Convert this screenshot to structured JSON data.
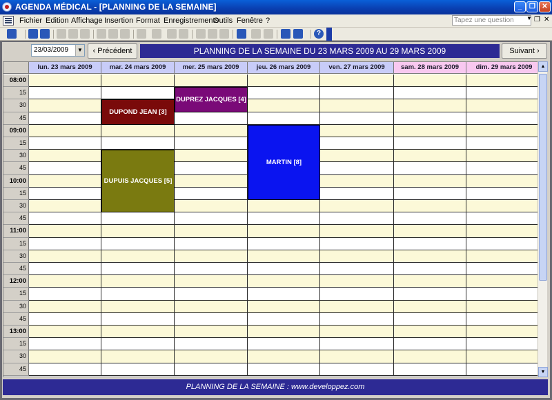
{
  "window": {
    "title": "AGENDA MÉDICAL - [PLANNING DE LA SEMAINE]",
    "minimize": "_",
    "maximize": "❐",
    "close": "✕"
  },
  "menu": {
    "items": [
      "Fichier",
      "Edition",
      "Affichage",
      "Insertion",
      "Format",
      "Enregistrements",
      "Outils",
      "Fenêtre",
      "?"
    ],
    "ask_placeholder": "Tapez une question",
    "ask_arrow": "▼",
    "doc_min": "_",
    "doc_restore": "❐",
    "doc_close": "✕"
  },
  "toolbar": {
    "icons": [
      "design-view-icon",
      "save-icon",
      "print-icon",
      "print-preview-icon",
      "spelling-icon",
      "cut-icon",
      "copy-icon",
      "paste-icon",
      "undo-icon",
      "hyperlink-icon",
      "sort-asc-icon",
      "sort-desc-icon",
      "filter-selection-icon",
      "filter-form-icon",
      "apply-filter-icon",
      "find-icon",
      "new-record-icon",
      "delete-record-icon",
      "database-window-icon",
      "new-object-icon",
      "help-icon"
    ],
    "help_label": "?"
  },
  "form": {
    "date_value": "23/03/2009",
    "date_dropdown": "▼",
    "prev_label": "‹  Précédent",
    "next_label": "Suivant  ›",
    "banner": "PLANNING DE LA SEMAINE DU 23 MARS 2009 AU 29 MARS 2009",
    "footer": "PLANNING DE LA SEMAINE : www.developpez.com"
  },
  "days": [
    {
      "label": "lun. 23 mars 2009",
      "color": "#c8ccf8"
    },
    {
      "label": "mar. 24 mars 2009",
      "color": "#c8ccf8"
    },
    {
      "label": "mer. 25 mars 2009",
      "color": "#c8ccf8"
    },
    {
      "label": "jeu. 26 mars 2009",
      "color": "#c8ccf8"
    },
    {
      "label": "ven. 27 mars 2009",
      "color": "#c8ccf8"
    },
    {
      "label": "sam. 28 mars 2009",
      "color": "#f8c8f0"
    },
    {
      "label": "dim. 29 mars 2009",
      "color": "#f8c8f0"
    }
  ],
  "times": [
    "08:00",
    "15",
    "30",
    "45",
    "09:00",
    "15",
    "30",
    "45",
    "10:00",
    "15",
    "30",
    "45",
    "11:00",
    "15",
    "30",
    "45",
    "12:00",
    "15",
    "30",
    "45",
    "13:00",
    "15",
    "30",
    "45"
  ],
  "appointments": [
    {
      "label": "DUPOND JEAN [3]",
      "day": 1,
      "start": "08:30",
      "end": "09:00",
      "color": "#7a0a0a"
    },
    {
      "label": "DUPREZ JACQUES [4]",
      "day": 2,
      "start": "08:15",
      "end": "08:45",
      "color": "#7a0a78"
    },
    {
      "label": "DUPUIS JACQUES [5]",
      "day": 1,
      "start": "09:30",
      "end": "10:45",
      "color": "#7a7a10"
    },
    {
      "label": "MARTIN [8]",
      "day": 3,
      "start": "09:00",
      "end": "10:30",
      "color": "#0a14f0"
    }
  ],
  "scrollbar": {
    "up": "▲",
    "down": "▼"
  }
}
